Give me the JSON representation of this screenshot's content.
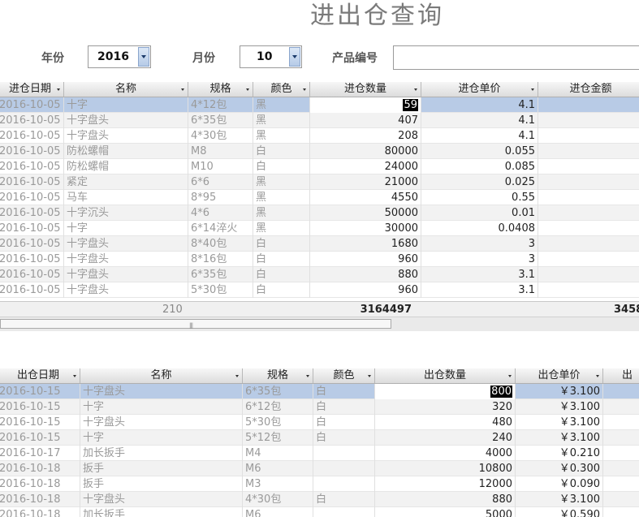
{
  "title": "进出仓查询",
  "filters": {
    "year_label": "年份",
    "year_value": "2016",
    "month_label": "月份",
    "month_value": "10",
    "product_label": "产品编号",
    "product_value": ""
  },
  "in_grid": {
    "headers": [
      "进仓日期",
      "名称",
      "规格",
      "颜色",
      "进仓数量",
      "进仓单价",
      "进仓金额"
    ],
    "rows": [
      {
        "date": "2016-10-05",
        "name": "十字",
        "spec": "4*12包",
        "color": "黑",
        "qty": "59",
        "price": "4.1"
      },
      {
        "date": "2016-10-05",
        "name": "十字盘头",
        "spec": "6*35包",
        "color": "黑",
        "qty": "407",
        "price": "4.1"
      },
      {
        "date": "2016-10-05",
        "name": "十字盘头",
        "spec": "4*30包",
        "color": "黑",
        "qty": "208",
        "price": "4.1"
      },
      {
        "date": "2016-10-05",
        "name": "防松螺帽",
        "spec": "M8",
        "color": "白",
        "qty": "80000",
        "price": "0.055"
      },
      {
        "date": "2016-10-05",
        "name": "防松螺帽",
        "spec": "M10",
        "color": "白",
        "qty": "24000",
        "price": "0.085"
      },
      {
        "date": "2016-10-05",
        "name": "紧定",
        "spec": "6*6",
        "color": "黑",
        "qty": "21000",
        "price": "0.025"
      },
      {
        "date": "2016-10-05",
        "name": "马车",
        "spec": "8*95",
        "color": "黑",
        "qty": "4550",
        "price": "0.55"
      },
      {
        "date": "2016-10-05",
        "name": "十字沉头",
        "spec": "4*6",
        "color": "黑",
        "qty": "50000",
        "price": "0.01"
      },
      {
        "date": "2016-10-05",
        "name": "十字",
        "spec": "6*14淬火",
        "color": "黑",
        "qty": "30000",
        "price": "0.0408"
      },
      {
        "date": "2016-10-05",
        "name": "十字盘头",
        "spec": "8*40包",
        "color": "白",
        "qty": "1680",
        "price": "3"
      },
      {
        "date": "2016-10-05",
        "name": "十字盘头",
        "spec": "8*16包",
        "color": "白",
        "qty": "960",
        "price": "3"
      },
      {
        "date": "2016-10-05",
        "name": "十字盘头",
        "spec": "6*35包",
        "color": "白",
        "qty": "880",
        "price": "3.1"
      },
      {
        "date": "2016-10-05",
        "name": "十字盘头",
        "spec": "5*30包",
        "color": "白",
        "qty": "960",
        "price": "3.1"
      }
    ],
    "totals": {
      "count": "210",
      "qty": "3164497",
      "amount": "3458"
    }
  },
  "out_grid": {
    "headers": [
      "出仓日期",
      "名称",
      "规格",
      "颜色",
      "出仓数量",
      "出仓单价",
      "出"
    ],
    "rows": [
      {
        "date": "2016-10-15",
        "name": "十字盘头",
        "spec": "6*35包",
        "color": "白",
        "qty": "800",
        "price": "￥3.100"
      },
      {
        "date": "2016-10-15",
        "name": "十字",
        "spec": "6*12包",
        "color": "白",
        "qty": "320",
        "price": "￥3.100"
      },
      {
        "date": "2016-10-15",
        "name": "十字盘头",
        "spec": "5*30包",
        "color": "白",
        "qty": "480",
        "price": "￥3.100"
      },
      {
        "date": "2016-10-15",
        "name": "十字",
        "spec": "5*12包",
        "color": "白",
        "qty": "240",
        "price": "￥3.100"
      },
      {
        "date": "2016-10-17",
        "name": "加长扳手",
        "spec": "M4",
        "color": "",
        "qty": "4000",
        "price": "￥0.210"
      },
      {
        "date": "2016-10-18",
        "name": "扳手",
        "spec": "M6",
        "color": "",
        "qty": "10800",
        "price": "￥0.300"
      },
      {
        "date": "2016-10-18",
        "name": "扳手",
        "spec": "M3",
        "color": "",
        "qty": "12000",
        "price": "￥0.090"
      },
      {
        "date": "2016-10-18",
        "name": "十字盘头",
        "spec": "4*30包",
        "color": "白",
        "qty": "880",
        "price": "￥3.100"
      },
      {
        "date": "2016-10-18",
        "name": "加长扳手",
        "spec": "M6",
        "color": "",
        "qty": "5000",
        "price": "￥0.590"
      }
    ]
  }
}
